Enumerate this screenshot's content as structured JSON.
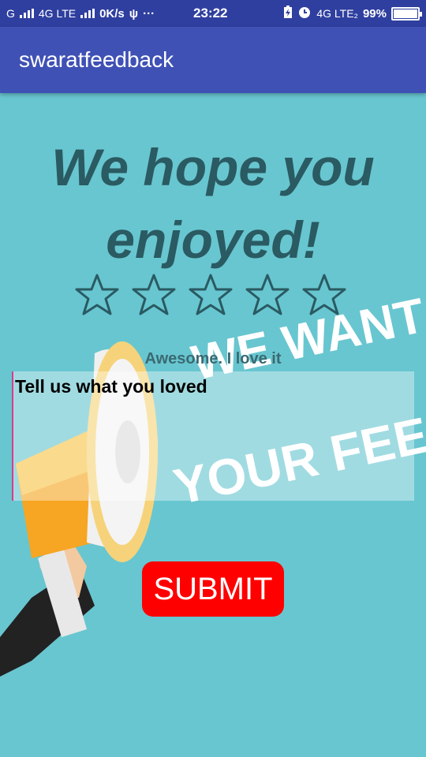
{
  "status_bar": {
    "carrier1": "G",
    "network1": "4G LTE",
    "speed": "0K/s",
    "more": "···",
    "time": "23:22",
    "network2": "4G LTE₂",
    "battery": "99%",
    "battery_level": 0.99
  },
  "app_bar": {
    "title": "swaratfeedback"
  },
  "main": {
    "headline": "We hope you enjoyed!",
    "rating": {
      "max": 5,
      "selected": 0
    },
    "rating_text": "Awesome. I love it",
    "feedback": {
      "placeholder": "Tell us what you loved",
      "value": ""
    },
    "submit_label": "SUBMIT",
    "background_art": {
      "line1": "WE WANT",
      "line2": "YOUR FEEDBACK"
    }
  },
  "colors": {
    "status_bar": "#2f3f9f",
    "app_bar": "#3f51b5",
    "background": "#68c6d0",
    "headline": "#2a5a62",
    "submit": "#ff0000"
  }
}
